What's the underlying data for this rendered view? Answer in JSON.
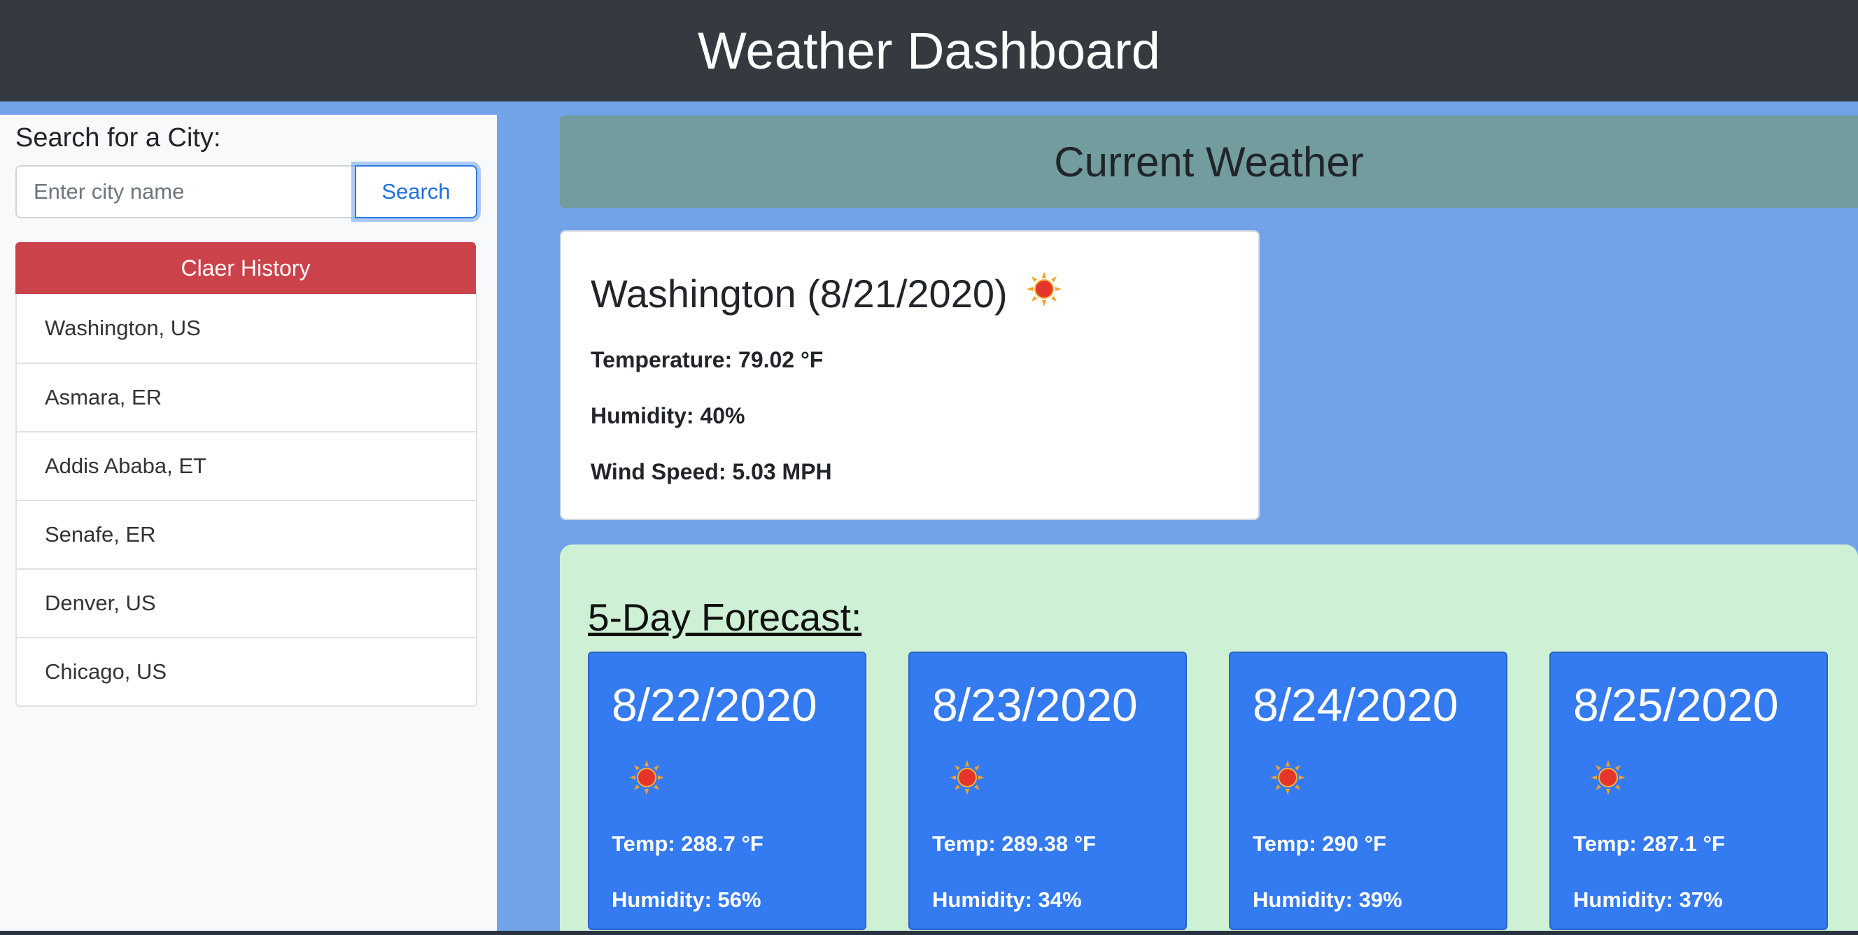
{
  "header": {
    "title": "Weather Dashboard"
  },
  "sidebar": {
    "search_label": "Search for a City:",
    "search_placeholder": "Enter city name",
    "search_button": "Search",
    "clear_button": "Claer History",
    "history": [
      {
        "label": "Washington, US"
      },
      {
        "label": "Asmara, ER"
      },
      {
        "label": "Addis Ababa, ET"
      },
      {
        "label": "Senafe, ER"
      },
      {
        "label": "Denver, US"
      },
      {
        "label": "Chicago, US"
      }
    ]
  },
  "current": {
    "header": "Current Weather",
    "city_date": "Washington (8/21/2020)",
    "icon": "sun-icon",
    "temperature": "Temperature: 79.02 °F",
    "humidity": "Humidity: 40%",
    "wind": "Wind Speed: 5.03 MPH"
  },
  "forecast": {
    "title": "5-Day Forecast:",
    "days": [
      {
        "date": "8/22/2020",
        "icon": "sun-icon",
        "temp": "Temp: 288.7 °F",
        "humidity": "Humidity: 56%"
      },
      {
        "date": "8/23/2020",
        "icon": "sun-icon",
        "temp": "Temp: 289.38 °F",
        "humidity": "Humidity: 34%"
      },
      {
        "date": "8/24/2020",
        "icon": "sun-icon",
        "temp": "Temp: 290 °F",
        "humidity": "Humidity: 39%"
      },
      {
        "date": "8/25/2020",
        "icon": "sun-icon",
        "temp": "Temp: 287.1 °F",
        "humidity": "Humidity: 37%"
      }
    ]
  },
  "colors": {
    "header_bg": "#343a40",
    "page_bg": "#72a3e9",
    "current_header_bg": "#729c9d",
    "forecast_bg": "#cef0d4",
    "forecast_card_bg": "#347af0",
    "clear_button_bg": "#cc424b"
  }
}
